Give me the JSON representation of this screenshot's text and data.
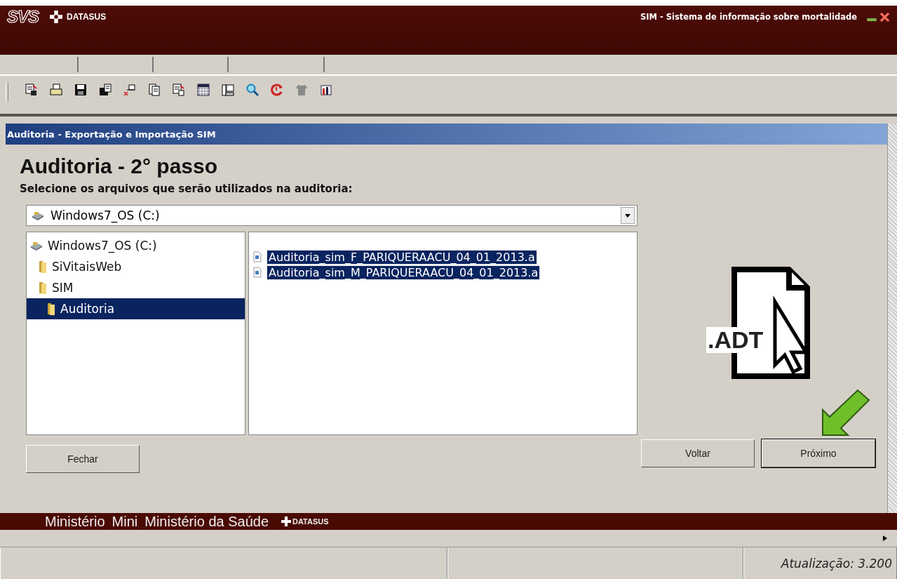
{
  "header": {
    "logo": "SVS",
    "brand": "DATASUS",
    "title": "SIM - Sistema de informação sobre mortalidade"
  },
  "dialog": {
    "title": "Auditoria - Exportação e Importação SIM",
    "heading": "Auditoria - 2° passo",
    "instruction": "Selecione os arquivos que serão utilizados na auditoria:",
    "drive": {
      "value": "Windows7_OS (C:)"
    },
    "tree": [
      {
        "label": "Windows7_OS (C:)",
        "kind": "drive",
        "selected": false,
        "children": [
          {
            "label": "SiVitaisWeb",
            "kind": "folder",
            "selected": false
          },
          {
            "label": "SIM",
            "kind": "folder",
            "selected": false,
            "children": [
              {
                "label": "Auditoria",
                "kind": "folder",
                "selected": true
              }
            ]
          }
        ]
      }
    ],
    "files": [
      {
        "name": "Auditoria_sim_F_PARIQUERAACU_04_01_2013.a",
        "selected": true
      },
      {
        "name": "Auditoria_sim_M_PARIQUERAACU_04_01_2013.a",
        "selected": true
      }
    ],
    "illustration": {
      "label": ".ADT"
    },
    "buttons": {
      "close": "Fechar",
      "back": "Voltar",
      "next": "Próximo"
    }
  },
  "footer": {
    "texts": [
      "Ministério",
      "Mini",
      "Ministério da Saúde"
    ],
    "brand": "DATASUS"
  },
  "status_bar": {
    "version": "Atualização: 3.200"
  }
}
